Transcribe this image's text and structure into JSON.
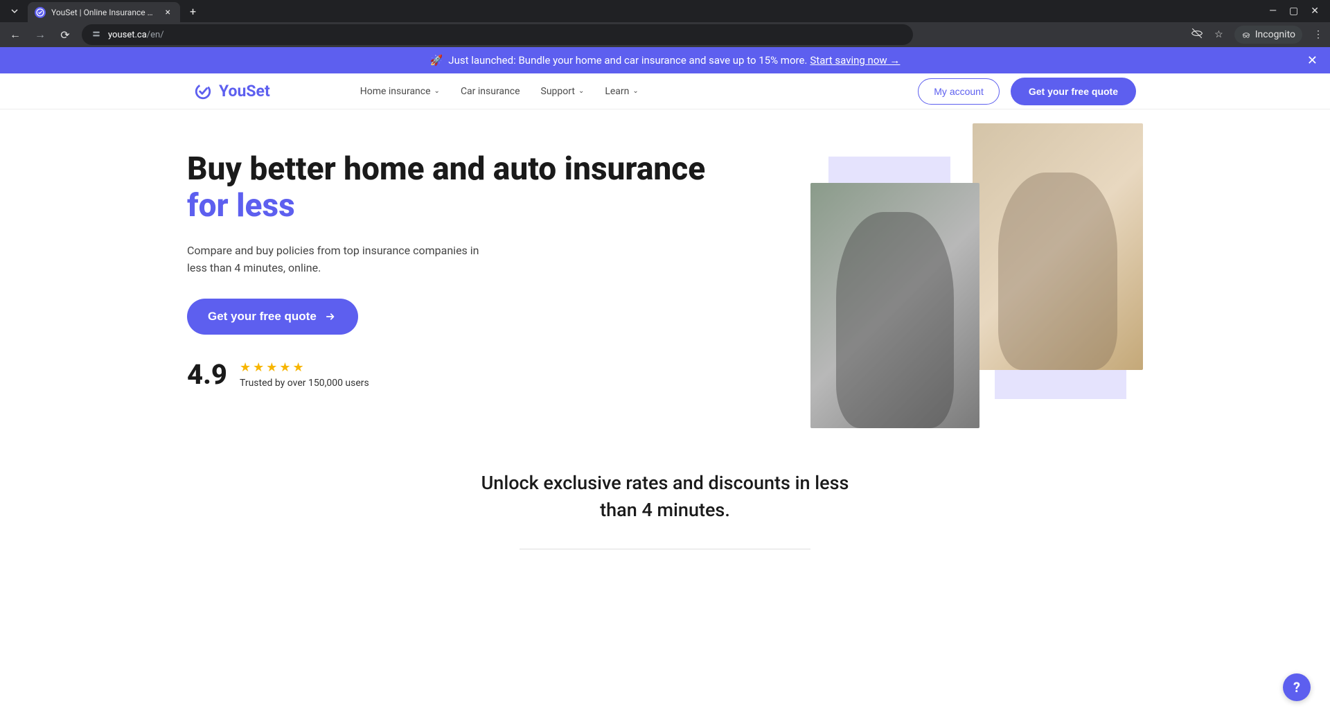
{
  "browser": {
    "tab_title": "YouSet | Online Insurance Quot",
    "url_domain": "youset.ca",
    "url_path": "/en/",
    "incognito_label": "Incognito"
  },
  "announce": {
    "emoji": "🚀",
    "text": "Just launched: Bundle your home and car insurance and save up to 15% more.",
    "link_text": "Start saving now →"
  },
  "header": {
    "logo_text": "YouSet",
    "nav": [
      {
        "label": "Home insurance",
        "has_dropdown": true
      },
      {
        "label": "Car insurance",
        "has_dropdown": false
      },
      {
        "label": "Support",
        "has_dropdown": true
      },
      {
        "label": "Learn",
        "has_dropdown": true
      }
    ],
    "my_account": "My account",
    "cta": "Get your free quote"
  },
  "hero": {
    "heading_line1": "Buy better home and auto insurance",
    "heading_accent": "for less",
    "subtext": "Compare and buy policies from top insurance companies in less than 4 minutes, online.",
    "cta": "Get your free quote",
    "rating_value": "4.9",
    "trusted_text": "Trusted by over 150,000 users"
  },
  "section2": {
    "heading": "Unlock exclusive rates and discounts in less than 4 minutes."
  },
  "help_fab": "?"
}
